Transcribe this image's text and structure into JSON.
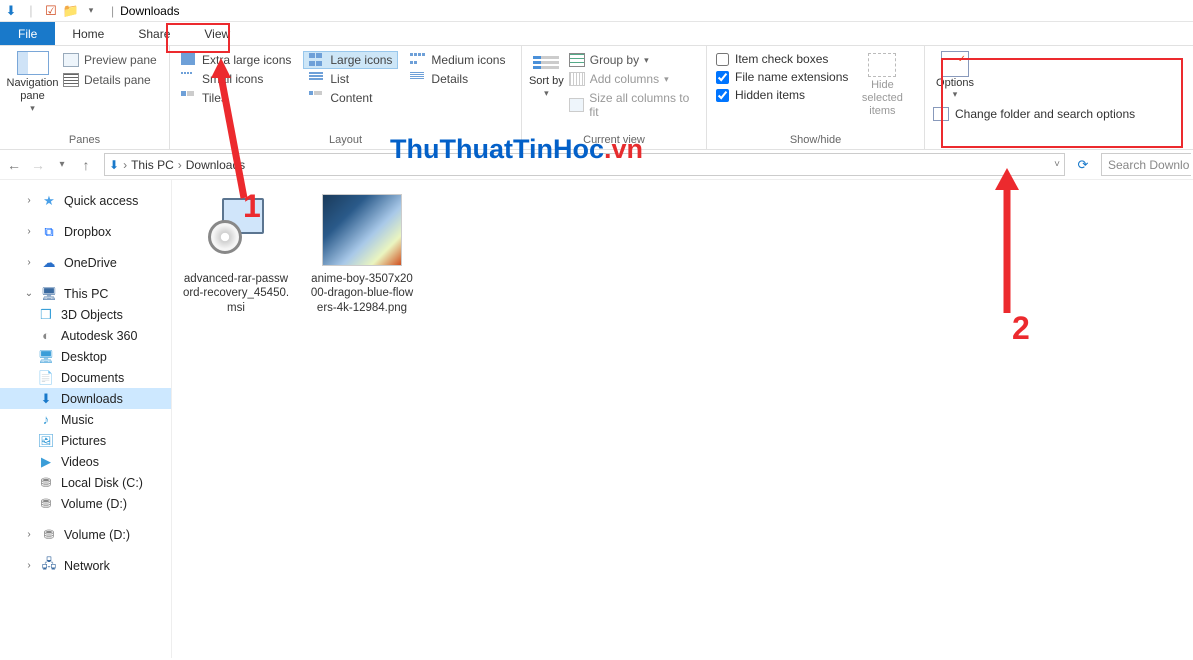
{
  "title_window": "Downloads",
  "tabs": {
    "file": "File",
    "home": "Home",
    "share": "Share",
    "view": "View"
  },
  "ribbon": {
    "panes": {
      "group_label": "Panes",
      "navigation_pane": "Navigation pane",
      "preview_pane": "Preview pane",
      "details_pane": "Details pane"
    },
    "layout": {
      "group_label": "Layout",
      "extra_large": "Extra large icons",
      "large": "Large icons",
      "medium": "Medium icons",
      "small": "Small icons",
      "list": "List",
      "details": "Details",
      "tiles": "Tiles",
      "content": "Content"
    },
    "current_view": {
      "group_label": "Current view",
      "sort_by": "Sort by",
      "group_by": "Group by",
      "add_columns": "Add columns",
      "size_all": "Size all columns to fit"
    },
    "show_hide": {
      "group_label": "Show/hide",
      "item_check": "Item check boxes",
      "file_ext": "File name extensions",
      "hidden": "Hidden items",
      "hide_selected": "Hide selected items"
    },
    "options": {
      "btn": "Options",
      "change_folder": "Change folder and search options"
    }
  },
  "breadcrumb": {
    "this_pc": "This PC",
    "downloads": "Downloads"
  },
  "search_placeholder": "Search Downlo",
  "nav": {
    "quick_access": "Quick access",
    "dropbox": "Dropbox",
    "onedrive": "OneDrive",
    "this_pc": "This PC",
    "objects3d": "3D Objects",
    "autodesk": "Autodesk 360",
    "desktop": "Desktop",
    "documents": "Documents",
    "downloads": "Downloads",
    "music": "Music",
    "pictures": "Pictures",
    "videos": "Videos",
    "local_c": "Local Disk (C:)",
    "vol_d1": "Volume (D:)",
    "vol_d2": "Volume (D:)",
    "network": "Network"
  },
  "files": {
    "f1": "advanced-rar-password-recovery_45450.msi",
    "f2": "anime-boy-3507x2000-dragon-blue-flowers-4k-12984.png"
  },
  "watermark_a": "ThuThuatTinHoc",
  "watermark_b": ".vn",
  "annotations": {
    "one": "1",
    "two": "2"
  }
}
